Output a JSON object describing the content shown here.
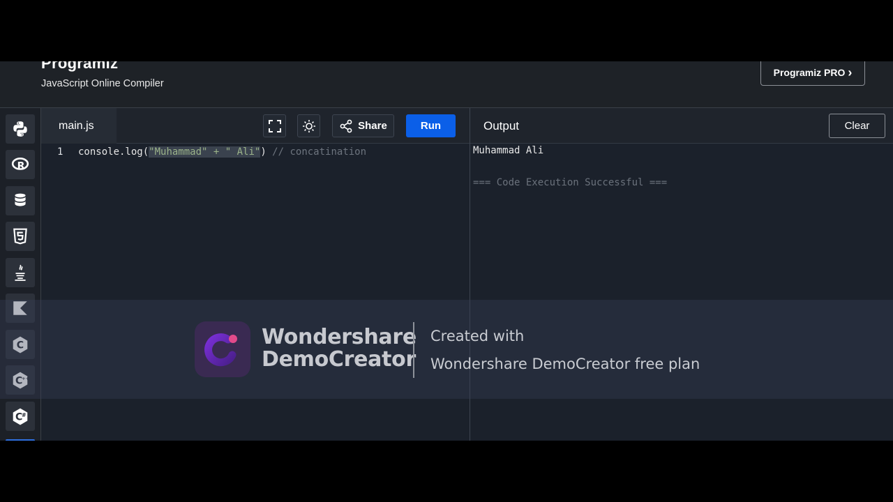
{
  "header": {
    "brand": "Programiz",
    "subtitle": "JavaScript Online Compiler",
    "pro_button": "Programiz PRO",
    "pro_chevron": "›"
  },
  "sidebar": {
    "items": [
      {
        "icon": "python-icon"
      },
      {
        "icon": "r-language-icon"
      },
      {
        "icon": "database-icon"
      },
      {
        "icon": "html5-icon"
      },
      {
        "icon": "java-icon"
      },
      {
        "icon": "kotlin-icon"
      },
      {
        "icon": "c-language-icon"
      },
      {
        "icon": "cpp-icon"
      },
      {
        "icon": "csharp-icon"
      }
    ]
  },
  "editor": {
    "filename": "main.js",
    "share_label": "Share",
    "run_label": "Run",
    "lines": [
      {
        "number": "1",
        "prefix": "console.log(",
        "string_selected": "\"Muhammad\" + \" Ali\"",
        "suffix": ")",
        "comment": " // concatination"
      }
    ]
  },
  "output": {
    "title": "Output",
    "clear_label": "Clear",
    "result": "Muhammad Ali",
    "status": "=== Code Execution Successful ==="
  },
  "watermark": {
    "brand_line1": "Wondershare",
    "brand_line2": "DemoCreator",
    "caption_line1": "Created with",
    "caption_line2": "Wondershare DemoCreator free plan"
  },
  "colors": {
    "run_button": "#0b5fe8",
    "background": "#1b212b",
    "comment": "#6d747e",
    "string": "#9bb38a"
  }
}
